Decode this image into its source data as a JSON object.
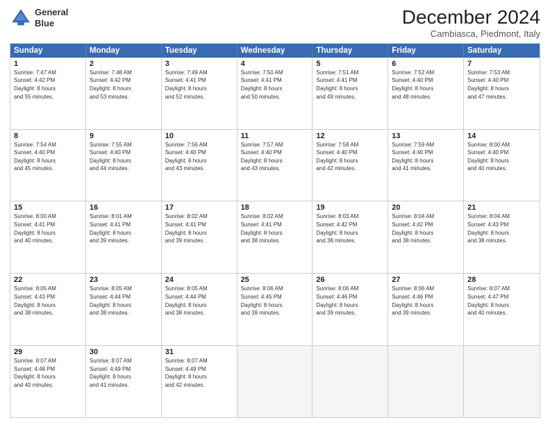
{
  "logo": {
    "line1": "General",
    "line2": "Blue"
  },
  "title": "December 2024",
  "subtitle": "Cambiasca, Piedmont, Italy",
  "header_days": [
    "Sunday",
    "Monday",
    "Tuesday",
    "Wednesday",
    "Thursday",
    "Friday",
    "Saturday"
  ],
  "rows": [
    [
      {
        "day": "1",
        "info": "Sunrise: 7:47 AM\nSunset: 4:42 PM\nDaylight: 8 hours\nand 55 minutes."
      },
      {
        "day": "2",
        "info": "Sunrise: 7:48 AM\nSunset: 4:42 PM\nDaylight: 8 hours\nand 53 minutes."
      },
      {
        "day": "3",
        "info": "Sunrise: 7:49 AM\nSunset: 4:41 PM\nDaylight: 8 hours\nand 52 minutes."
      },
      {
        "day": "4",
        "info": "Sunrise: 7:50 AM\nSunset: 4:41 PM\nDaylight: 8 hours\nand 50 minutes."
      },
      {
        "day": "5",
        "info": "Sunrise: 7:51 AM\nSunset: 4:41 PM\nDaylight: 8 hours\nand 49 minutes."
      },
      {
        "day": "6",
        "info": "Sunrise: 7:52 AM\nSunset: 4:40 PM\nDaylight: 8 hours\nand 48 minutes."
      },
      {
        "day": "7",
        "info": "Sunrise: 7:53 AM\nSunset: 4:40 PM\nDaylight: 8 hours\nand 47 minutes."
      }
    ],
    [
      {
        "day": "8",
        "info": "Sunrise: 7:54 AM\nSunset: 4:40 PM\nDaylight: 8 hours\nand 45 minutes."
      },
      {
        "day": "9",
        "info": "Sunrise: 7:55 AM\nSunset: 4:40 PM\nDaylight: 8 hours\nand 44 minutes."
      },
      {
        "day": "10",
        "info": "Sunrise: 7:56 AM\nSunset: 4:40 PM\nDaylight: 8 hours\nand 43 minutes."
      },
      {
        "day": "11",
        "info": "Sunrise: 7:57 AM\nSunset: 4:40 PM\nDaylight: 8 hours\nand 43 minutes."
      },
      {
        "day": "12",
        "info": "Sunrise: 7:58 AM\nSunset: 4:40 PM\nDaylight: 8 hours\nand 42 minutes."
      },
      {
        "day": "13",
        "info": "Sunrise: 7:59 AM\nSunset: 4:40 PM\nDaylight: 8 hours\nand 41 minutes."
      },
      {
        "day": "14",
        "info": "Sunrise: 8:00 AM\nSunset: 4:40 PM\nDaylight: 8 hours\nand 40 minutes."
      }
    ],
    [
      {
        "day": "15",
        "info": "Sunrise: 8:00 AM\nSunset: 4:41 PM\nDaylight: 8 hours\nand 40 minutes."
      },
      {
        "day": "16",
        "info": "Sunrise: 8:01 AM\nSunset: 4:41 PM\nDaylight: 8 hours\nand 39 minutes."
      },
      {
        "day": "17",
        "info": "Sunrise: 8:02 AM\nSunset: 4:41 PM\nDaylight: 8 hours\nand 39 minutes."
      },
      {
        "day": "18",
        "info": "Sunrise: 8:02 AM\nSunset: 4:41 PM\nDaylight: 8 hours\nand 38 minutes."
      },
      {
        "day": "19",
        "info": "Sunrise: 8:03 AM\nSunset: 4:42 PM\nDaylight: 8 hours\nand 38 minutes."
      },
      {
        "day": "20",
        "info": "Sunrise: 8:04 AM\nSunset: 4:42 PM\nDaylight: 8 hours\nand 38 minutes."
      },
      {
        "day": "21",
        "info": "Sunrise: 8:04 AM\nSunset: 4:43 PM\nDaylight: 8 hours\nand 38 minutes."
      }
    ],
    [
      {
        "day": "22",
        "info": "Sunrise: 8:05 AM\nSunset: 4:43 PM\nDaylight: 8 hours\nand 38 minutes."
      },
      {
        "day": "23",
        "info": "Sunrise: 8:05 AM\nSunset: 4:44 PM\nDaylight: 8 hours\nand 38 minutes."
      },
      {
        "day": "24",
        "info": "Sunrise: 8:05 AM\nSunset: 4:44 PM\nDaylight: 8 hours\nand 38 minutes."
      },
      {
        "day": "25",
        "info": "Sunrise: 8:06 AM\nSunset: 4:45 PM\nDaylight: 8 hours\nand 39 minutes."
      },
      {
        "day": "26",
        "info": "Sunrise: 8:06 AM\nSunset: 4:46 PM\nDaylight: 8 hours\nand 39 minutes."
      },
      {
        "day": "27",
        "info": "Sunrise: 8:06 AM\nSunset: 4:46 PM\nDaylight: 8 hours\nand 39 minutes."
      },
      {
        "day": "28",
        "info": "Sunrise: 8:07 AM\nSunset: 4:47 PM\nDaylight: 8 hours\nand 40 minutes."
      }
    ],
    [
      {
        "day": "29",
        "info": "Sunrise: 8:07 AM\nSunset: 4:48 PM\nDaylight: 8 hours\nand 40 minutes."
      },
      {
        "day": "30",
        "info": "Sunrise: 8:07 AM\nSunset: 4:49 PM\nDaylight: 8 hours\nand 41 minutes."
      },
      {
        "day": "31",
        "info": "Sunrise: 8:07 AM\nSunset: 4:49 PM\nDaylight: 8 hours\nand 42 minutes."
      },
      {
        "day": "",
        "info": ""
      },
      {
        "day": "",
        "info": ""
      },
      {
        "day": "",
        "info": ""
      },
      {
        "day": "",
        "info": ""
      }
    ]
  ]
}
